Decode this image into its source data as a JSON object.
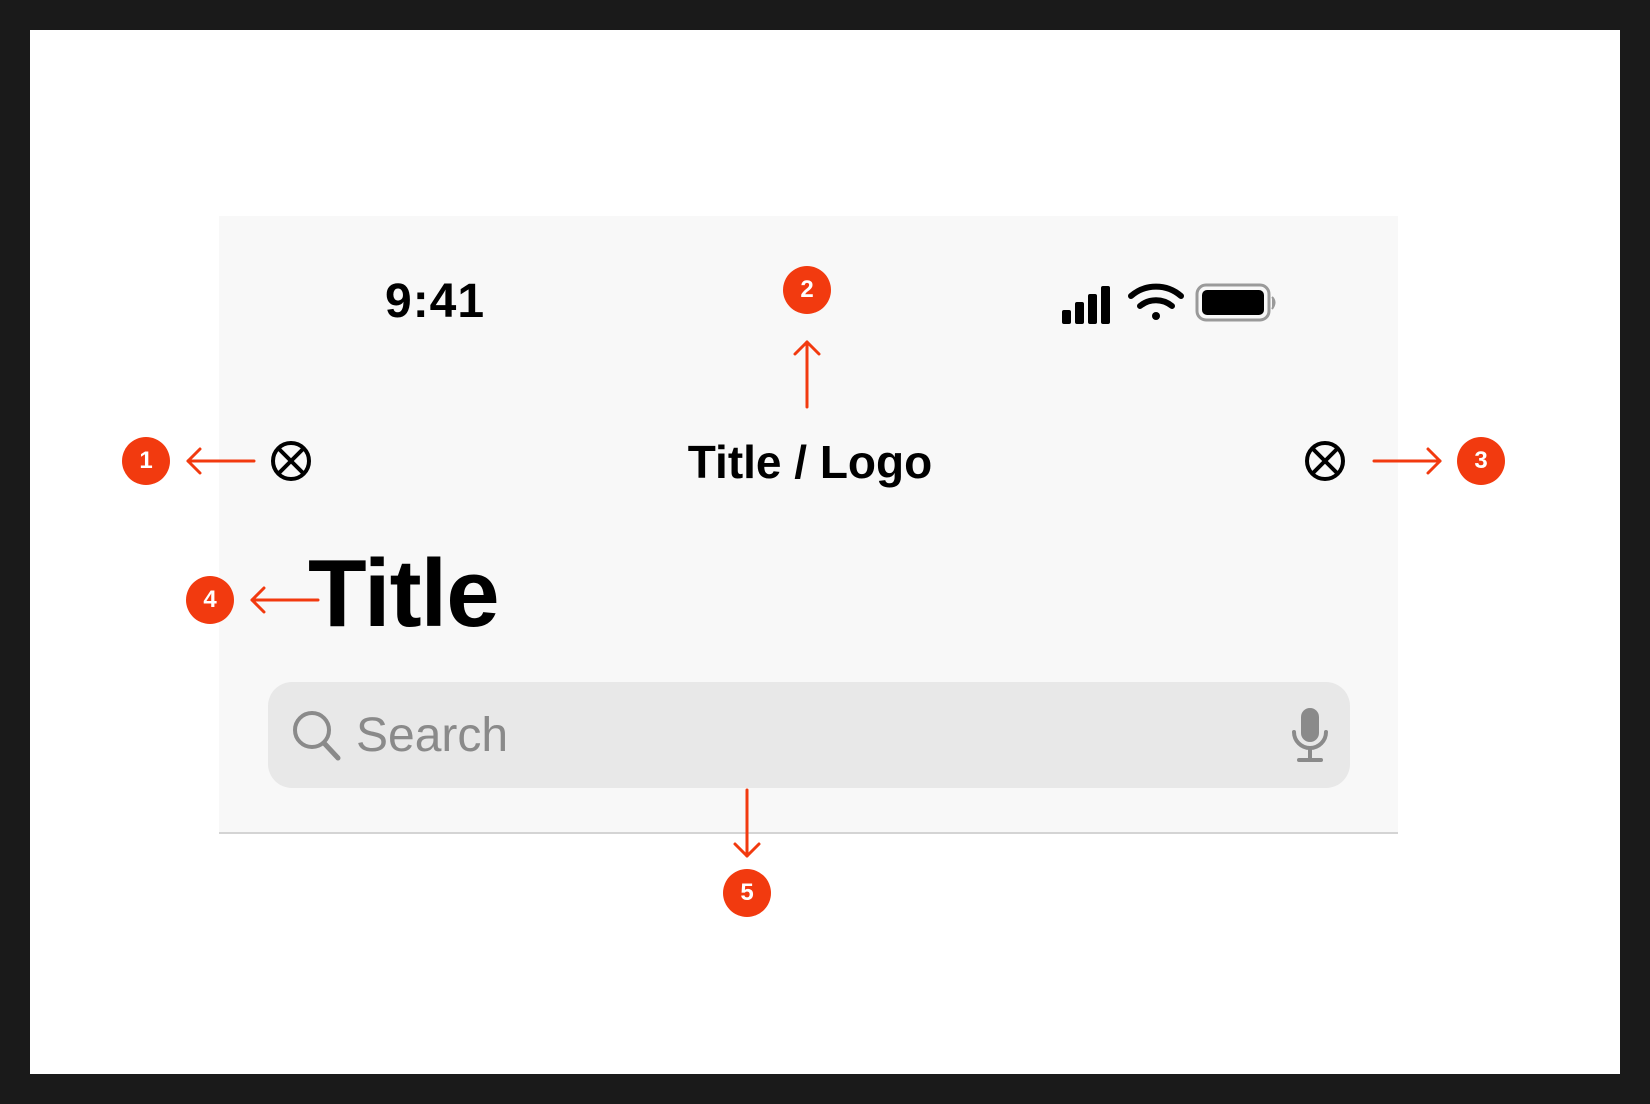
{
  "status_bar": {
    "time": "9:41",
    "icons": [
      "cellular-signal-icon",
      "wifi-icon",
      "battery-icon"
    ]
  },
  "nav_bar": {
    "leading_icon": "close-circle-icon",
    "title": "Title / Logo",
    "trailing_icon": "close-circle-icon"
  },
  "large_title": "Title",
  "search": {
    "placeholder": "Search",
    "icon": "search-icon",
    "accessory_icon": "mic-icon"
  },
  "annotations": {
    "color": "#f23a0f",
    "badges": [
      "1",
      "2",
      "3",
      "4",
      "5"
    ]
  },
  "colors": {
    "frame": "#1a1a1a",
    "canvas": "#ffffff",
    "screen": "#f8f8f8",
    "search_fill": "#e8e8e8",
    "placeholder": "#8a8a8a"
  }
}
